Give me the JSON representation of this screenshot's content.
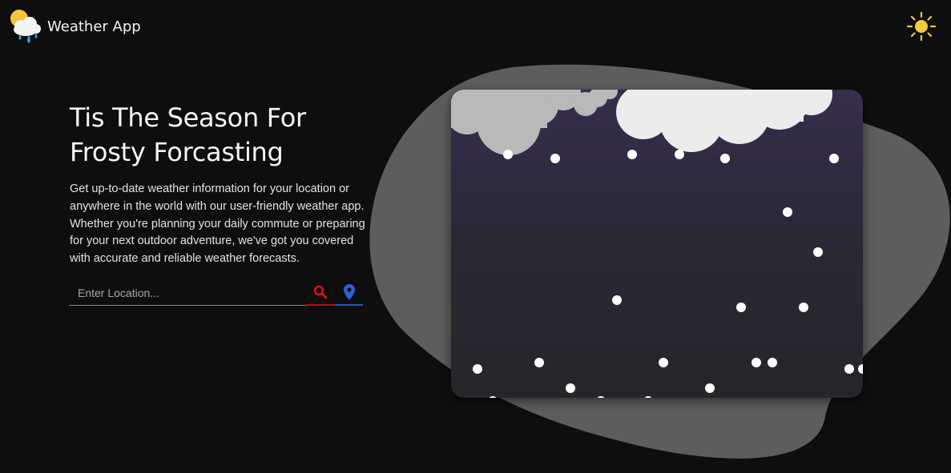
{
  "header": {
    "app_title": "Weather App",
    "logo_icon": "cloud-sun-rain-icon",
    "theme_toggle_icon": "sun-icon"
  },
  "hero": {
    "title_line1": "Tis The Season For",
    "title_line2": "Frosty Forcasting",
    "description": "Get up-to-date weather information for your location or anywhere in the world with our user-friendly weather app. Whether you're planning your daily commute or preparing for your next outdoor adventure, we've got you covered with accurate and reliable weather forecasts."
  },
  "search": {
    "placeholder": "Enter Location...",
    "value": "",
    "search_icon": "search-icon",
    "location_icon": "location-pin-icon"
  },
  "illustration": {
    "scene": "snowy-night",
    "icons": [
      "cloud-icon",
      "snowflake-icon"
    ]
  },
  "colors": {
    "background": "#0e0e0e",
    "search_accent": "#b40f0f",
    "location_accent": "#2553c6",
    "sun": "#f5c842"
  }
}
